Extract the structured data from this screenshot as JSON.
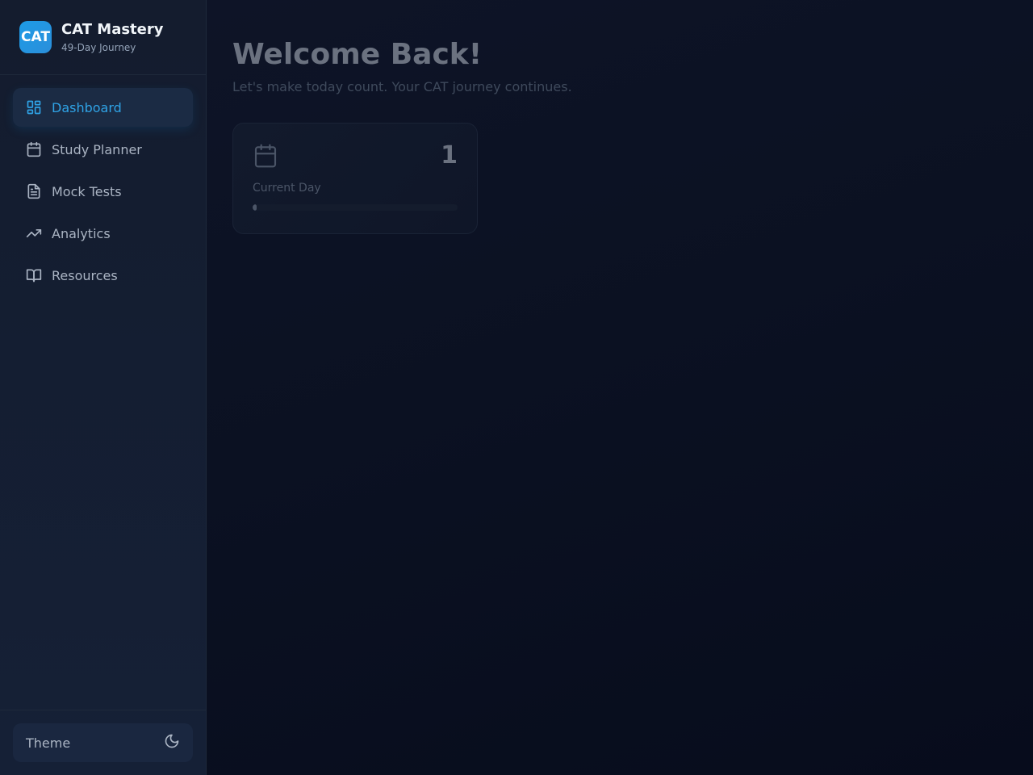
{
  "brand": {
    "logo_text": "CAT",
    "title": "CAT Mastery",
    "subtitle": "49-Day Journey"
  },
  "nav": {
    "items": [
      {
        "label": "Dashboard",
        "icon": "dashboard-icon",
        "active": true
      },
      {
        "label": "Study Planner",
        "icon": "calendar-icon",
        "active": false
      },
      {
        "label": "Mock Tests",
        "icon": "document-icon",
        "active": false
      },
      {
        "label": "Analytics",
        "icon": "trending-up-icon",
        "active": false
      },
      {
        "label": "Resources",
        "icon": "book-icon",
        "active": false
      }
    ]
  },
  "footer": {
    "theme_label": "Theme",
    "theme_icon": "moon-icon"
  },
  "main": {
    "title": "Welcome Back!",
    "subtitle": "Let's make today count. Your CAT journey continues.",
    "card": {
      "icon": "calendar-icon",
      "value": "1",
      "label": "Current Day",
      "progress": {
        "current": 1,
        "total": 49
      }
    }
  },
  "colors": {
    "accent": "#2fa3e6",
    "logo": "#1d9be6",
    "sidebar_bg": "#141c2e",
    "main_bg": "#0b1122"
  }
}
